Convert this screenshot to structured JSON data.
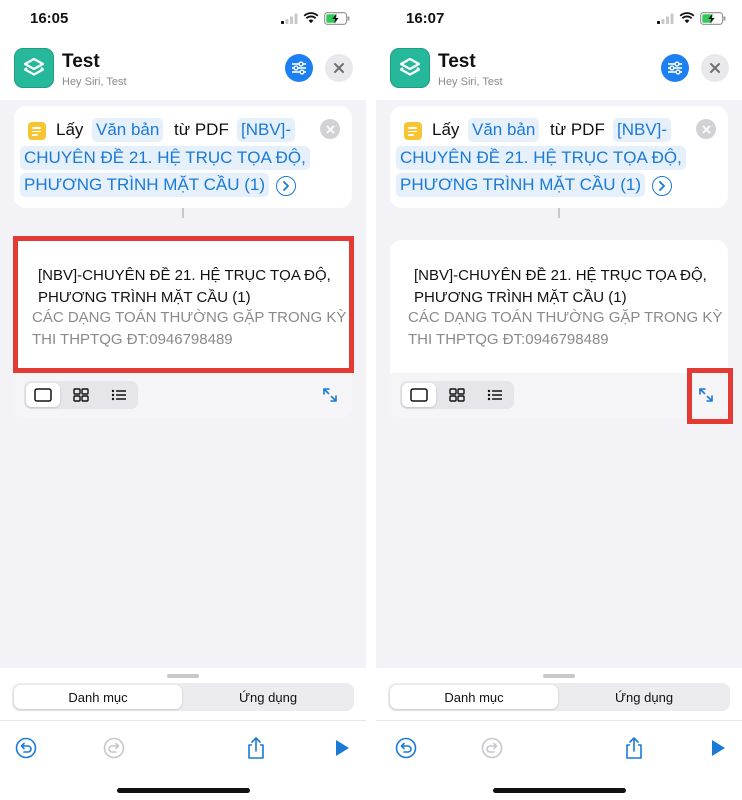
{
  "colors": {
    "accent": "#1a7ad6",
    "highlight": "#e33b33",
    "app_icon": "#26b89a",
    "doc_icon": "#f7c531"
  },
  "screens": [
    {
      "status": {
        "time": "16:05"
      },
      "header": {
        "title": "Test",
        "subtitle": "Hey Siri, Test",
        "icon": "shortcuts-icon"
      },
      "action": {
        "verb": "Lấy",
        "token_type": "Văn bản",
        "from": "từ PDF",
        "token_line1": "[NBV]-",
        "token_line2": "CHUYÊN ĐỀ 21. HỆ TRỤC TỌA ĐỘ,",
        "token_line3": "PHƯƠNG TRÌNH MẶT CẦU (1)"
      },
      "result": {
        "line1": "[NBV]-CHUYÊN ĐỀ 21. HỆ TRỤC TỌA ĐỘ,",
        "line2": "PHƯƠNG TRÌNH MẶT CẦU (1)",
        "sub1": "CÁC DẠNG TOÁN THƯỜNG GẶP TRONG KỲ",
        "sub2": "THI THPTQG ĐT:0946798489"
      },
      "tabs": [
        "Danh mục",
        "Ứng dụng"
      ],
      "highlight": "result-card"
    },
    {
      "status": {
        "time": "16:07"
      },
      "header": {
        "title": "Test",
        "subtitle": "Hey Siri, Test",
        "icon": "shortcuts-icon"
      },
      "action": {
        "verb": "Lấy",
        "token_type": "Văn bản",
        "from": "từ PDF",
        "token_line1": "[NBV]-",
        "token_line2": "CHUYÊN ĐỀ 21. HỆ TRỤC TỌA ĐỘ,",
        "token_line3": "PHƯƠNG TRÌNH MẶT CẦU (1)"
      },
      "result": {
        "line1": "[NBV]-CHUYÊN ĐỀ 21. HỆ TRỤC TỌA ĐỘ,",
        "line2": "PHƯƠNG TRÌNH MẶT CẦU (1)",
        "sub1": "CÁC DẠNG TOÁN THƯỜNG GẶP TRONG KỲ",
        "sub2": "THI THPTQG ĐT:0946798489"
      },
      "tabs": [
        "Danh mục",
        "Ứng dụng"
      ],
      "highlight": "expand-button"
    }
  ]
}
